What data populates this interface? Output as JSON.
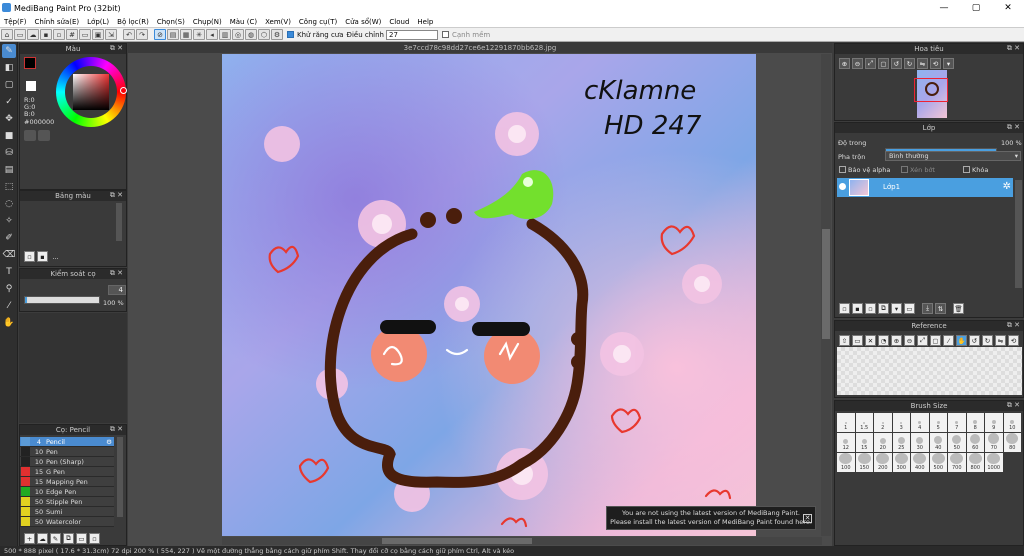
{
  "window": {
    "title": "MediBang Paint Pro (32bit)",
    "min": "—",
    "max": "▢",
    "close": "✕"
  },
  "menu": [
    "Tệp(F)",
    "Chỉnh sửa(E)",
    "Lớp(L)",
    "Bộ lọc(R)",
    "Chọn(S)",
    "Chụp(N)",
    "Màu (C)",
    "Xem(V)",
    "Công cụ(T)",
    "Cửa sổ(W)",
    "Cloud",
    "Help"
  ],
  "toolbar": {
    "antialias_label": "Khử răng cưa",
    "correction_label": "Điều chỉnh",
    "correction_value": "27",
    "snap_label": "Cạnh mềm"
  },
  "document": {
    "filename": "3e7ccd78c98dd27ce6e12291870bb628.jpg"
  },
  "color_panel": {
    "title": "Màu",
    "r": "R:0",
    "g": "G:0",
    "b": "B:0",
    "hex": "#000000",
    "primary_color": "#000000",
    "secondary_color": "#ffffff"
  },
  "palette_panel": {
    "title": "Bảng màu"
  },
  "brush_control": {
    "title": "Kiểm soát cọ",
    "size_value": "4",
    "opacity_value": "100 %",
    "opacity_fraction": 1.0,
    "size_fraction": 0.98
  },
  "brush_panel": {
    "title": "Cọ: Pencil",
    "brushes": [
      {
        "size": "4",
        "name": "Pencil",
        "color": "#5b9ad6",
        "selected": true
      },
      {
        "size": "10",
        "name": "Pen",
        "color": "#222222",
        "selected": false
      },
      {
        "size": "10",
        "name": "Pen (Sharp)",
        "color": "#222222",
        "selected": false
      },
      {
        "size": "15",
        "name": "G Pen",
        "color": "#e03030",
        "selected": false
      },
      {
        "size": "15",
        "name": "Mapping Pen",
        "color": "#e03030",
        "selected": false
      },
      {
        "size": "10",
        "name": "Edge Pen",
        "color": "#22aa22",
        "selected": false
      },
      {
        "size": "50",
        "name": "Stipple Pen",
        "color": "#e0d020",
        "selected": false
      },
      {
        "size": "50",
        "name": "Sumi",
        "color": "#e0d020",
        "selected": false
      },
      {
        "size": "50",
        "name": "Watercolor",
        "color": "#e0d020",
        "selected": false
      }
    ]
  },
  "navigator": {
    "title": "Hoa tiêu"
  },
  "layer_panel": {
    "title": "Lớp",
    "opacity_label": "Độ trong",
    "opacity_value": "100 %",
    "opacity_fraction": 1.0,
    "blend_label": "Pha trộn",
    "blend_value": "Bình thường",
    "protect_alpha": "Bảo vệ alpha",
    "clipping": "Xén bớt",
    "lock": "Khóa",
    "layer_name": "Lớp1"
  },
  "reference_panel": {
    "title": "Reference"
  },
  "brush_size_panel": {
    "title": "Brush Size",
    "sizes": [
      "1",
      "1.5",
      "2",
      "3",
      "4",
      "5",
      "7",
      "8",
      "9",
      "10",
      "12",
      "15",
      "20",
      "25",
      "30",
      "40",
      "50",
      "60",
      "70",
      "80",
      "100",
      "150",
      "200",
      "300",
      "400",
      "500",
      "700",
      "800",
      "1000"
    ]
  },
  "artwork": {
    "text_line1": "cKlamne",
    "text_line2": "HD 247"
  },
  "toast": {
    "line1": "You are not using the latest version of MediBang Paint.",
    "line2": "Please install the latest version of MediBang Paint found here.",
    "close": "✕"
  },
  "status": {
    "text": "500 * 888 pixel   ( 17.6 * 31.3cm)   72 dpi   200 %   ( 554, 227 )   Vẽ một đường thẳng bằng cách giữ phím Shift. Thay đổi cỡ cọ bằng cách giữ phím Ctrl, Alt và kéo"
  }
}
